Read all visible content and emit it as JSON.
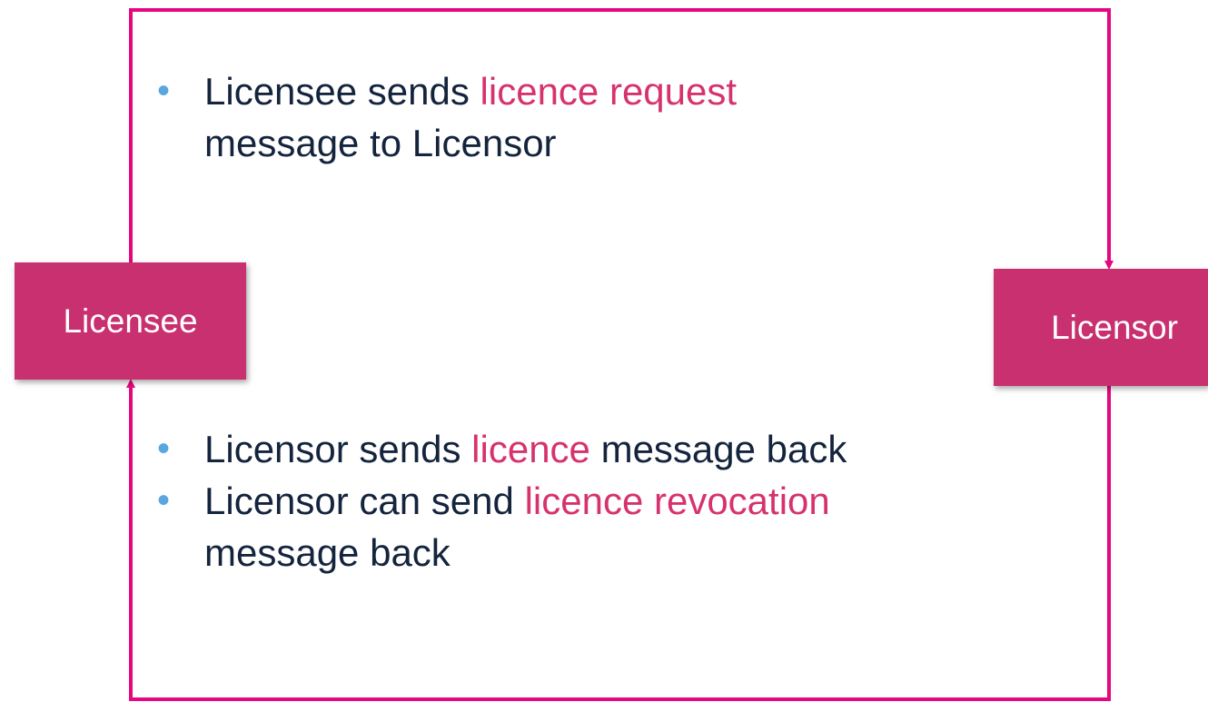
{
  "colors": {
    "connector": "#e5077e",
    "node_fill": "#c8306f",
    "highlight": "#d6336e",
    "text": "#14243d",
    "bullet": "#5aa6de"
  },
  "nodes": {
    "licensee": "Licensee",
    "licensor": "Licensor"
  },
  "top_bullets": [
    {
      "before": "Licensee sends ",
      "highlight": "licence request",
      "after": "",
      "line2": "message to Licensor"
    }
  ],
  "bottom_bullets": [
    {
      "before": "Licensor sends ",
      "highlight": "licence",
      "after": " message back",
      "line2": ""
    },
    {
      "before": "Licensor can send ",
      "highlight": "licence revocation",
      "after": "",
      "line2": "message back"
    }
  ]
}
